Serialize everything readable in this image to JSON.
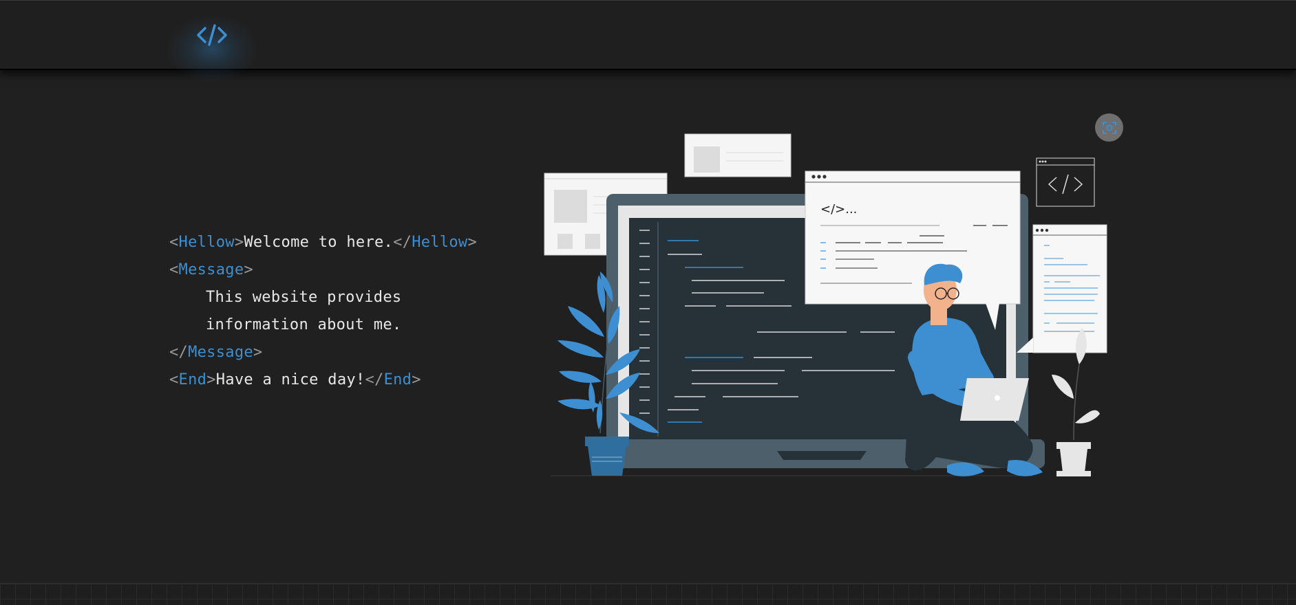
{
  "header": {
    "logo_icon": "code-brackets-icon",
    "accent_color": "#3d8fd1"
  },
  "intro": {
    "line1": {
      "open_tag": "Hellow",
      "text": "Welcome to here.",
      "close_tag": "Hellow"
    },
    "line2": {
      "open_tag": "Message"
    },
    "line3": {
      "text": "This website provides"
    },
    "line4": {
      "text": "information about me."
    },
    "line5": {
      "close_tag": "Message"
    },
    "line6": {
      "open_tag": "End",
      "text": "Have a nice day!",
      "close_tag": "End"
    }
  },
  "illustration": {
    "speech_bubble_text": "</>..."
  },
  "scan_button": {
    "icon": "scan-icon"
  }
}
